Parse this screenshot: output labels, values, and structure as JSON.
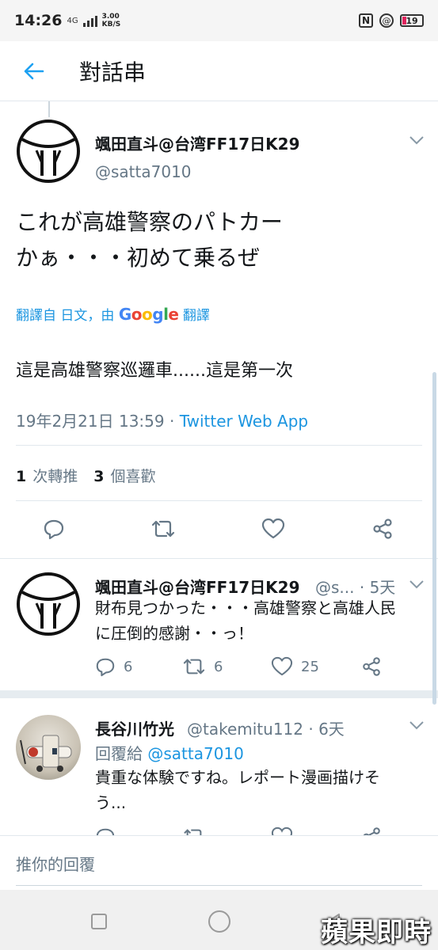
{
  "status_bar": {
    "time": "14:26",
    "network": "4G",
    "speed_value": "3.00",
    "speed_unit": "KB/S",
    "battery": "19"
  },
  "header": {
    "title": "對話串"
  },
  "main_tweet": {
    "name": "颯田直斗@台湾FF17日K29",
    "handle": "@satta7010",
    "text_line1": "これが高雄警察のパトカー",
    "text_line2": "かぁ・・・初めて乗るぜ",
    "translate_prefix": "翻譯自 日文，由",
    "translate_provider": "Google",
    "translate_suffix": "翻譯",
    "translated_text": "這是高雄警察巡邏車......這是第一次",
    "timestamp": "19年2月21日 13:59",
    "separator": " · ",
    "source_app": "Twitter Web App",
    "retweet_count": "1",
    "retweet_label": "次轉推",
    "like_count": "3",
    "like_label": "個喜歡"
  },
  "reply1": {
    "name": "颯田直斗@台湾FF17日K29",
    "handle_time": "@s... · 5天",
    "text_line1": "財布見つかった・・・高雄警察と高雄人民",
    "text_line2": "に圧倒的感謝・・っ！",
    "reply_count": "6",
    "retweet_count": "6",
    "like_count": "25"
  },
  "reply2": {
    "name": "長谷川竹光",
    "handle_time": "@takemitu112 · 6天",
    "replying_label": "回覆給",
    "replying_to": "@satta7010",
    "text_line1": "貴重な体験ですね。レポート漫画描けそ",
    "text_line2": "う..."
  },
  "compose": {
    "placeholder": "推你的回覆"
  },
  "watermark": "蘋果即時",
  "colors": {
    "accent": "#1da1f2",
    "link": "#1b95e0",
    "muted": "#657786"
  }
}
